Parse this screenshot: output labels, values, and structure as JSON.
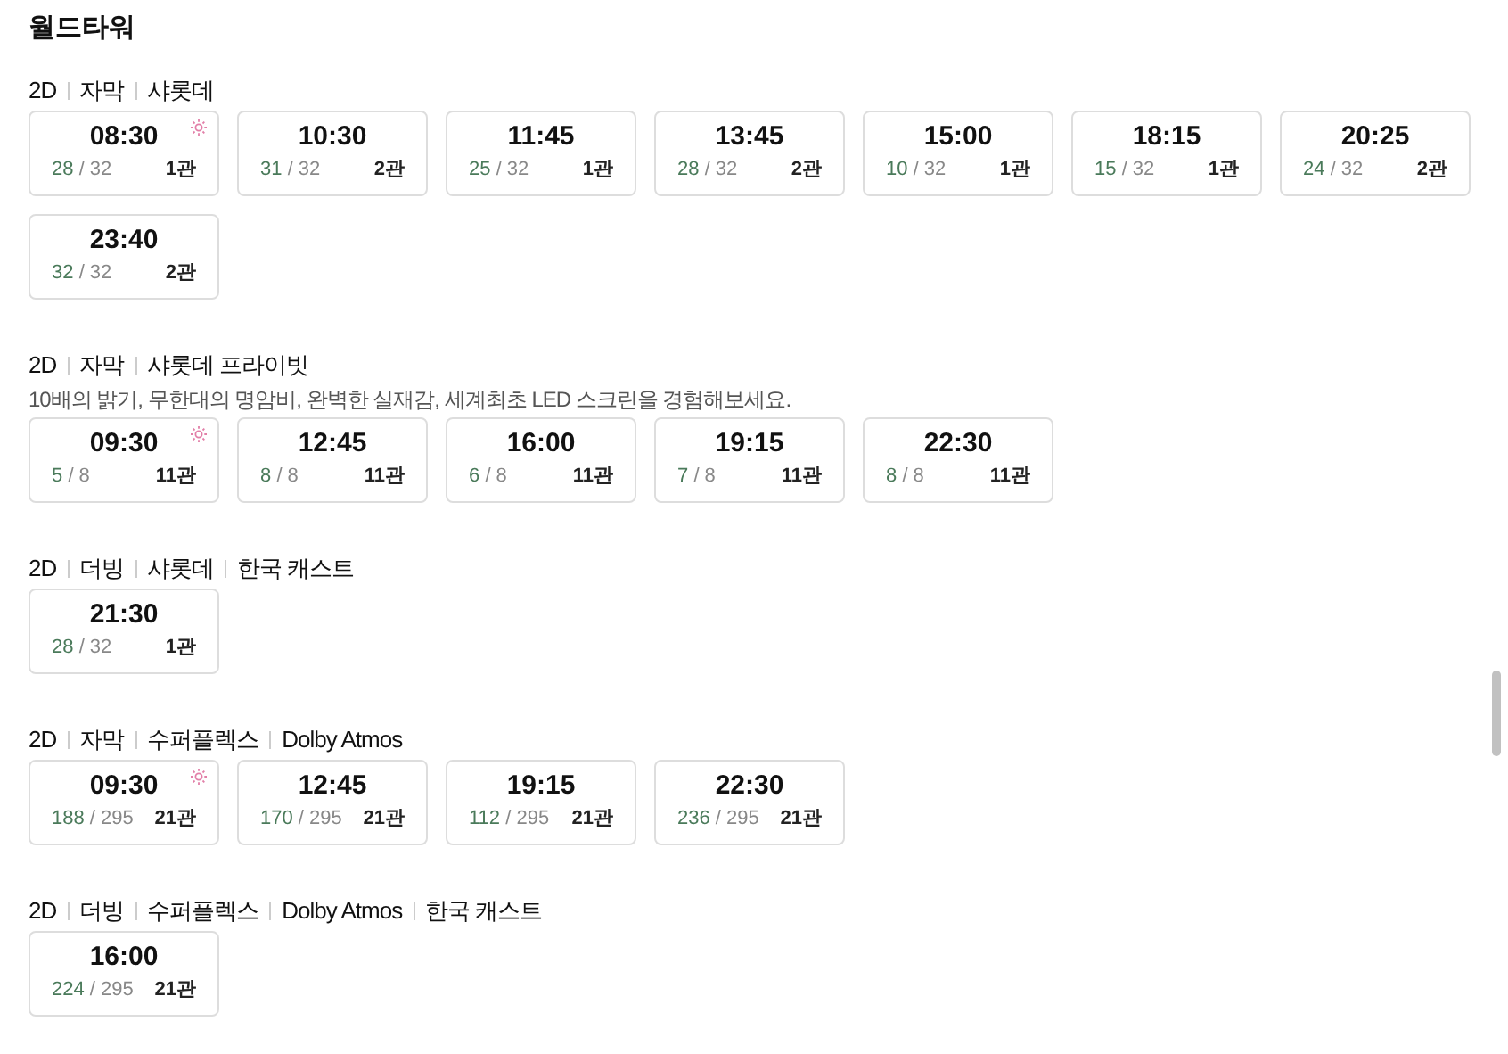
{
  "title": "월드타워",
  "groups": [
    {
      "tags": [
        "2D",
        "자막",
        "샤롯데"
      ],
      "showtimes": [
        {
          "time": "08:30",
          "remaining": "28",
          "total": "/ 32",
          "hall": "1관",
          "morning": true
        },
        {
          "time": "10:30",
          "remaining": "31",
          "total": "/ 32",
          "hall": "2관",
          "morning": false
        },
        {
          "time": "11:45",
          "remaining": "25",
          "total": "/ 32",
          "hall": "1관",
          "morning": false
        },
        {
          "time": "13:45",
          "remaining": "28",
          "total": "/ 32",
          "hall": "2관",
          "morning": false
        },
        {
          "time": "15:00",
          "remaining": "10",
          "total": "/ 32",
          "hall": "1관",
          "morning": false
        },
        {
          "time": "18:15",
          "remaining": "15",
          "total": "/ 32",
          "hall": "1관",
          "morning": false
        },
        {
          "time": "20:25",
          "remaining": "24",
          "total": "/ 32",
          "hall": "2관",
          "morning": false
        },
        {
          "time": "23:40",
          "remaining": "32",
          "total": "/ 32",
          "hall": "2관",
          "morning": false
        }
      ]
    },
    {
      "tags": [
        "2D",
        "자막",
        "샤롯데 프라이빗"
      ],
      "description": "10배의 밝기, 무한대의 명암비, 완벽한 실재감, 세계최초 LED 스크린을 경험해보세요.",
      "showtimes": [
        {
          "time": "09:30",
          "remaining": "5",
          "total": "/ 8",
          "hall": "11관",
          "morning": true
        },
        {
          "time": "12:45",
          "remaining": "8",
          "total": "/ 8",
          "hall": "11관",
          "morning": false
        },
        {
          "time": "16:00",
          "remaining": "6",
          "total": "/ 8",
          "hall": "11관",
          "morning": false
        },
        {
          "time": "19:15",
          "remaining": "7",
          "total": "/ 8",
          "hall": "11관",
          "morning": false
        },
        {
          "time": "22:30",
          "remaining": "8",
          "total": "/ 8",
          "hall": "11관",
          "morning": false
        }
      ]
    },
    {
      "tags": [
        "2D",
        "더빙",
        "샤롯데",
        "한국 캐스트"
      ],
      "showtimes": [
        {
          "time": "21:30",
          "remaining": "28",
          "total": "/ 32",
          "hall": "1관",
          "morning": false
        }
      ]
    },
    {
      "tags": [
        "2D",
        "자막",
        "수퍼플렉스",
        "Dolby Atmos"
      ],
      "showtimes": [
        {
          "time": "09:30",
          "remaining": "188",
          "total": "/ 295",
          "hall": "21관",
          "morning": true
        },
        {
          "time": "12:45",
          "remaining": "170",
          "total": "/ 295",
          "hall": "21관",
          "morning": false
        },
        {
          "time": "19:15",
          "remaining": "112",
          "total": "/ 295",
          "hall": "21관",
          "morning": false
        },
        {
          "time": "22:30",
          "remaining": "236",
          "total": "/ 295",
          "hall": "21관",
          "morning": false
        }
      ]
    },
    {
      "tags": [
        "2D",
        "더빙",
        "수퍼플렉스",
        "Dolby Atmos",
        "한국 캐스트"
      ],
      "showtimes": [
        {
          "time": "16:00",
          "remaining": "224",
          "total": "/ 295",
          "hall": "21관",
          "morning": false
        }
      ]
    }
  ]
}
